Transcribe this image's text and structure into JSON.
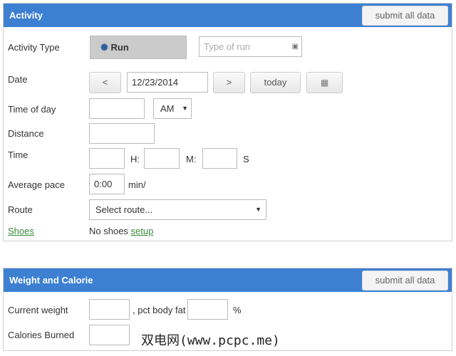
{
  "activity": {
    "title": "Activity",
    "submit": "submit all data",
    "type_label": "Activity Type",
    "type_value": "Run",
    "type_of_run_placeholder": "Type of run",
    "date_label": "Date",
    "prev": "<",
    "date": "12/23/2014",
    "next": ">",
    "today": "today",
    "time_of_day_label": "Time of day",
    "ampm": "AM",
    "distance_label": "Distance",
    "time_label": "Time",
    "h": "H:",
    "m": "M:",
    "s": "S",
    "pace_label": "Average pace",
    "pace": "0:00",
    "pace_unit": "min/",
    "route_label": "Route",
    "route": "Select route...",
    "shoes_label": "Shoes",
    "no_shoes": "No shoes",
    "setup": "setup"
  },
  "weight": {
    "title": "Weight and Calorie",
    "submit": "submit all data",
    "current_weight_label": "Current weight",
    "body_fat_label": ", pct body fat",
    "percent": "%",
    "calories_label": "Calories Burned"
  },
  "watermark": "双电网(www.pcpc.me)"
}
